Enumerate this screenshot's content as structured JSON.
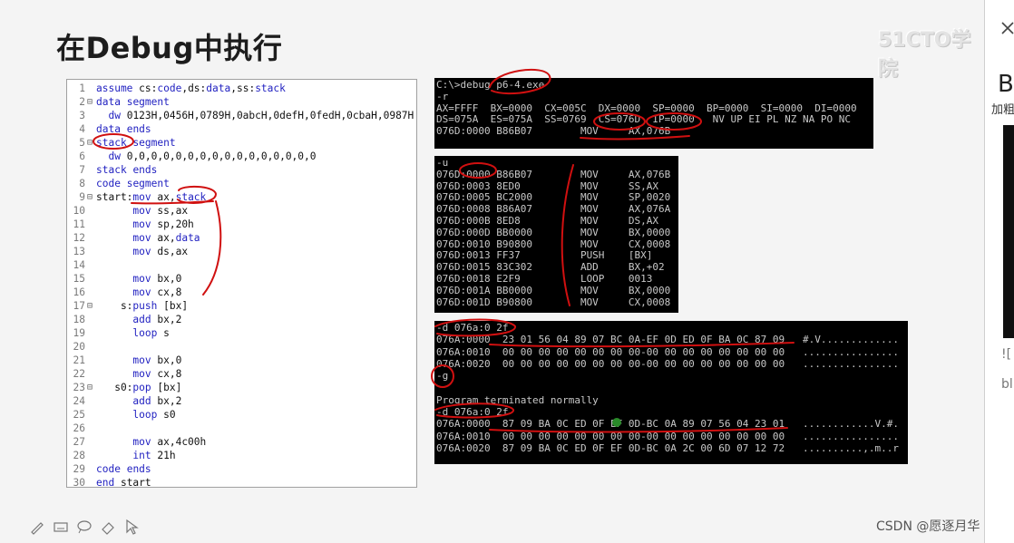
{
  "slide": {
    "title": "在Debug中执行",
    "watermark": "51CTO学院",
    "credit": "CSDN @愿逐月华"
  },
  "code": {
    "lines": [
      {
        "n": "1",
        "fold": "",
        "text": "assume cs:code,ds:data,ss:stack"
      },
      {
        "n": "2",
        "fold": "⊟",
        "text": "data segment"
      },
      {
        "n": "3",
        "fold": "",
        "text": "  dw 0123H,0456H,0789H,0abcH,0defH,0fedH,0cbaH,0987H"
      },
      {
        "n": "4",
        "fold": "",
        "text": "data ends"
      },
      {
        "n": "5",
        "fold": "⊟",
        "text": "stack segment"
      },
      {
        "n": "6",
        "fold": "",
        "text": "  dw 0,0,0,0,0,0,0,0,0,0,0,0,0,0,0,0"
      },
      {
        "n": "7",
        "fold": "",
        "text": "stack ends"
      },
      {
        "n": "8",
        "fold": "",
        "text": "code segment"
      },
      {
        "n": "9",
        "fold": "⊟",
        "text": "start:mov ax,stack"
      },
      {
        "n": "10",
        "fold": "",
        "text": "      mov ss,ax"
      },
      {
        "n": "11",
        "fold": "",
        "text": "      mov sp,20h"
      },
      {
        "n": "12",
        "fold": "",
        "text": "      mov ax,data"
      },
      {
        "n": "13",
        "fold": "",
        "text": "      mov ds,ax"
      },
      {
        "n": "14",
        "fold": "",
        "text": ""
      },
      {
        "n": "15",
        "fold": "",
        "text": "      mov bx,0"
      },
      {
        "n": "16",
        "fold": "",
        "text": "      mov cx,8"
      },
      {
        "n": "17",
        "fold": "⊟",
        "text": "    s:push [bx]"
      },
      {
        "n": "18",
        "fold": "",
        "text": "      add bx,2"
      },
      {
        "n": "19",
        "fold": "",
        "text": "      loop s"
      },
      {
        "n": "20",
        "fold": "",
        "text": ""
      },
      {
        "n": "21",
        "fold": "",
        "text": "      mov bx,0"
      },
      {
        "n": "22",
        "fold": "",
        "text": "      mov cx,8"
      },
      {
        "n": "23",
        "fold": "⊟",
        "text": "   s0:pop [bx]"
      },
      {
        "n": "24",
        "fold": "",
        "text": "      add bx,2"
      },
      {
        "n": "25",
        "fold": "",
        "text": "      loop s0"
      },
      {
        "n": "26",
        "fold": "",
        "text": ""
      },
      {
        "n": "27",
        "fold": "",
        "text": "      mov ax,4c00h"
      },
      {
        "n": "28",
        "fold": "",
        "text": "      int 21h"
      },
      {
        "n": "29",
        "fold": "",
        "text": "code ends"
      },
      {
        "n": "30",
        "fold": "",
        "text": "end start"
      }
    ]
  },
  "debug_screens": [
    {
      "id": "registers",
      "lines": [
        "C:\\>debug p6-4.exe",
        "-r",
        "AX=FFFF  BX=0000  CX=005C  DX=0000  SP=0000  BP=0000  SI=0000  DI=0000",
        "DS=075A  ES=075A  SS=0769  CS=076D  IP=0000   NV UP EI PL NZ NA PO NC",
        "076D:0000 B86B07        MOV     AX,076B"
      ]
    },
    {
      "id": "unassemble",
      "lines": [
        "-u",
        "076D:0000 B86B07        MOV     AX,076B",
        "076D:0003 8ED0          MOV     SS,AX",
        "076D:0005 BC2000        MOV     SP,0020",
        "076D:0008 B86A07        MOV     AX,076A",
        "076D:000B 8ED8          MOV     DS,AX",
        "076D:000D BB0000        MOV     BX,0000",
        "076D:0010 B90800        MOV     CX,0008",
        "076D:0013 FF37          PUSH    [BX]",
        "076D:0015 83C302        ADD     BX,+02",
        "076D:0018 E2F9          LOOP    0013",
        "076D:001A BB0000        MOV     BX,0000",
        "076D:001D B90800        MOV     CX,0008"
      ]
    },
    {
      "id": "dump",
      "lines": [
        "-d 076a:0 2f",
        "076A:0000  23 01 56 04 89 07 BC 0A-EF 0D ED 0F BA 0C 87 09   #.V.............",
        "076A:0010  00 00 00 00 00 00 00 00-00 00 00 00 00 00 00 00   ................",
        "076A:0020  00 00 00 00 00 00 00 00-00 00 00 00 00 00 00 00   ................",
        "-g",
        "",
        "Program terminated normally",
        "-d 076a:0 2f",
        "076A:0000  87 09 BA 0C ED 0F EF 0D-BC 0A 89 07 56 04 23 01   ............V.#.",
        "076A:0010  00 00 00 00 00 00 00 00-00 00 00 00 00 00 00 00   ................",
        "076A:0020  87 09 BA 0C ED 0F EF 0D-BC 0A 2C 00 6D 07 12 72   ..........,.m..r"
      ]
    }
  ],
  "sidebar": {
    "letter": "B",
    "sub": "加粗",
    "alt": "![",
    "alt2": "bl"
  },
  "colors": {
    "annotation": "#d01010",
    "keyword": "#1f1fc0"
  },
  "toolbar": {
    "icons": [
      "pen-icon",
      "keyboard-icon",
      "lasso-icon",
      "eraser-icon",
      "pointer-icon"
    ]
  }
}
